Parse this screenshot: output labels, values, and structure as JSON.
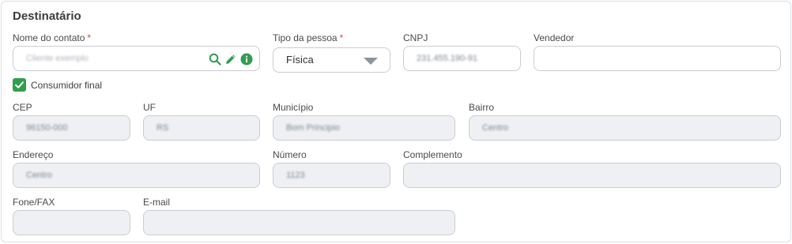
{
  "section": {
    "title": "Destinatário"
  },
  "contact": {
    "label": "Nome do contato",
    "required_mark": "*",
    "placeholder": "Cliente exemplo"
  },
  "person_type": {
    "label": "Tipo da pessoa",
    "required_mark": "*",
    "value": "Física"
  },
  "cnpj": {
    "label": "CNPJ",
    "value": "231.455.190-91"
  },
  "seller": {
    "label": "Vendedor",
    "value": ""
  },
  "final_consumer": {
    "label": "Consumidor final",
    "checked": true
  },
  "cep": {
    "label": "CEP",
    "value": "96150-000"
  },
  "uf": {
    "label": "UF",
    "value": "RS"
  },
  "municipio": {
    "label": "Município",
    "value": "Bom Principio"
  },
  "bairro": {
    "label": "Bairro",
    "value": "Centro"
  },
  "endereco": {
    "label": "Endereço",
    "value": "Centro"
  },
  "numero": {
    "label": "Número",
    "value": "1123"
  },
  "complemento": {
    "label": "Complemento",
    "value": ""
  },
  "fone": {
    "label": "Fone/FAX",
    "value": ""
  },
  "email": {
    "label": "E-mail",
    "value": ""
  },
  "icons": [
    "search-icon",
    "edit-icon",
    "info-icon"
  ],
  "colors": {
    "accent": "#2f9e4f",
    "required": "#e04a4a",
    "disabled_bg": "#eef0f4"
  }
}
